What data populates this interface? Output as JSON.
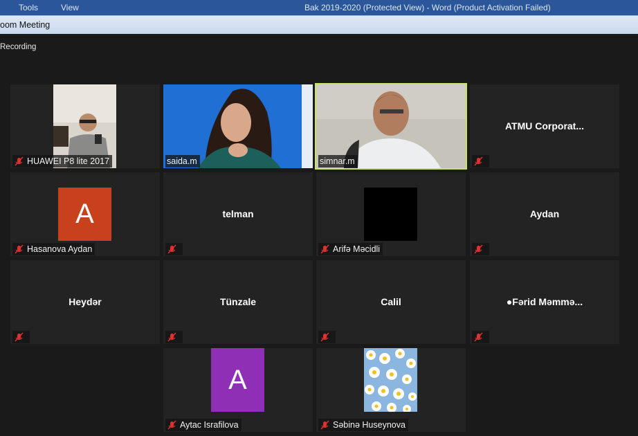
{
  "word": {
    "menu_tools": "Tools",
    "menu_view": "View",
    "title": "Bak 2019-2020 (Protected View) - Word (Product Activation Failed)"
  },
  "zoom": {
    "window_title": "oom Meeting",
    "recording": "Recording"
  },
  "colors": {
    "active_speaker_border": "#c9e560",
    "avatar_orange": "#c8401c",
    "avatar_purple": "#8e2fb5",
    "tile_bg": "#232323"
  },
  "participants": [
    {
      "name": "HUAWEI P8 lite 2017",
      "muted": true,
      "video": true
    },
    {
      "name": "saida.m",
      "muted": false,
      "video": true
    },
    {
      "name": "simnar.m",
      "muted": false,
      "video": true,
      "active": true
    },
    {
      "name": "ATMU  Corporat...",
      "muted": true,
      "video": false
    },
    {
      "name": "Hasanova Aydan",
      "muted": true,
      "avatar_letter": "A"
    },
    {
      "name": "telman",
      "muted": true,
      "video": false
    },
    {
      "name": "Arifə Məcidli",
      "muted": true,
      "avatar": "black"
    },
    {
      "name": "Aydan",
      "muted": true,
      "video": false
    },
    {
      "name": "Heydər",
      "muted": true,
      "video": false
    },
    {
      "name": "Tünzale",
      "muted": true,
      "video": false
    },
    {
      "name": "Calil",
      "muted": true,
      "video": false
    },
    {
      "name": "●Fərid  Məmmə...",
      "muted": true,
      "video": false
    },
    {
      "name": "Aytac Israfilova",
      "muted": true,
      "avatar_letter": "A"
    },
    {
      "name": "Səbinə Huseynova",
      "muted": true,
      "avatar": "flowers"
    }
  ]
}
